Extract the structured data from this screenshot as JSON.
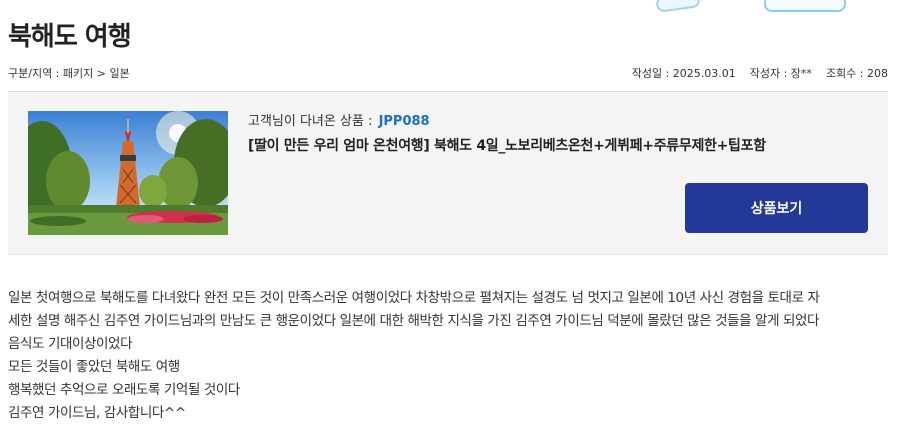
{
  "title": "북해도 여행",
  "meta": {
    "category": "구분/지역 : 패키지 > 일본",
    "date": "작성일 : 2025.03.01",
    "author": "작성자 : 장**",
    "views": "조회수 : 208"
  },
  "product": {
    "label": "고객님이 다녀온 상품 :",
    "code": "JPP088",
    "name": "[딸이 만든 우리 엄마 온천여행] 북해도 4일_노보리베츠온천+게뷔페+주류무제한+팁포함",
    "button_label": "상품보기"
  },
  "review": {
    "lines": [
      "일본 첫여행으로 북해도를 다녀왔다 완전 모든 것이 만족스러운 여행이었다 차창밖으로 펼쳐지는 설경도 넘 멋지고 일본에 10년 사신 경험을 토대로 자",
      "세한 설명 해주신 김주연 가이드님과의 만남도 큰 행운이었다 일본에 대한 해박한 지식을 가진 김주연 가이드님 덕분에 몰랐던 많은 것들을 알게 되었다",
      "음식도 기대이상이었다",
      "모든 것들이 좋았던 북해도 여행",
      "행복했던 추억으로 오래도록 기억될 것이다",
      "김주연 가이드님, 감사합니다^^"
    ]
  },
  "colors": {
    "accent_button": "#23399a",
    "product_code": "#1a6fd0"
  }
}
